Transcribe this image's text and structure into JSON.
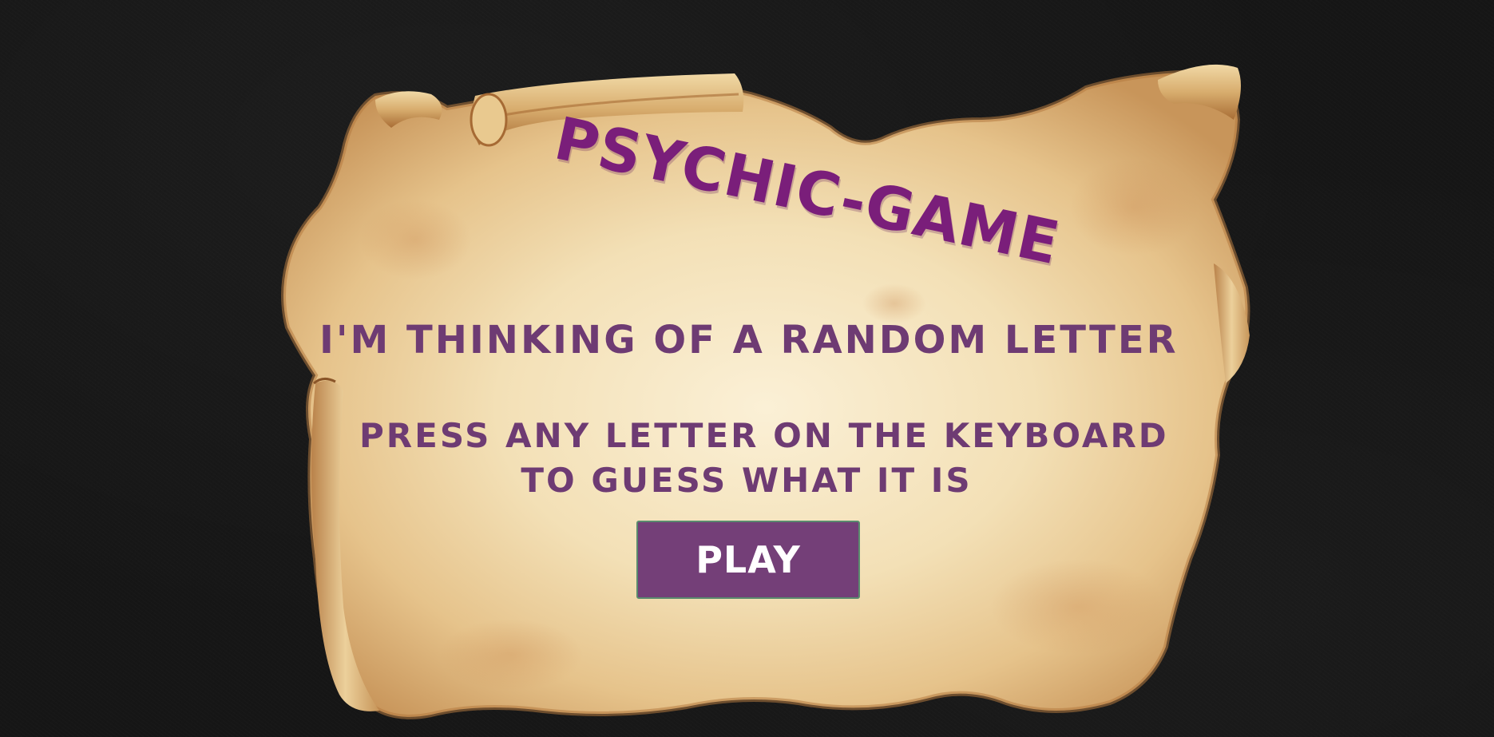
{
  "game": {
    "title": "PSYCHIC-GAME",
    "subtitle": "I'M THINKING OF A RANDOM LETTER",
    "instructions": {
      "line1": "PRESS ANY LETTER ON THE KEYBOARD",
      "line2": "TO GUESS WHAT IT IS"
    },
    "play_label": "PLAY"
  },
  "colors": {
    "background": "#161616",
    "title": "#7a1e7a",
    "text": "#6e3b73",
    "button": "#743f78",
    "button_text": "#ffffff",
    "parchment": "#f3dfb4"
  }
}
